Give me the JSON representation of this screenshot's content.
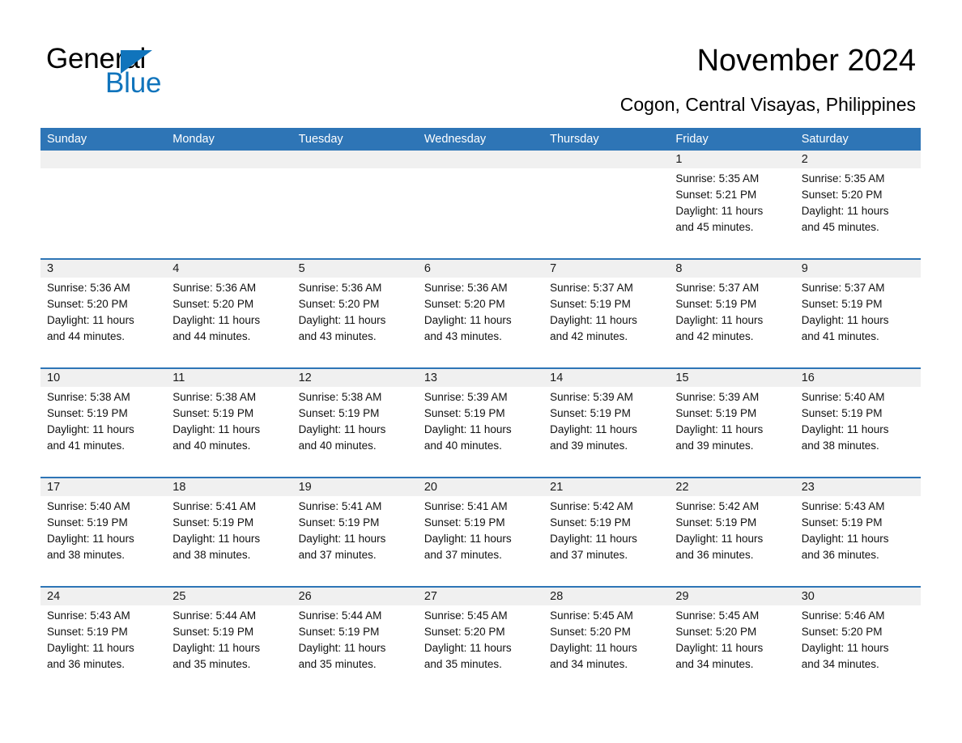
{
  "brand": {
    "name_part1": "General",
    "name_part2": "Blue",
    "accent_color": "#1074bc",
    "triangle_icon": "triangle-icon"
  },
  "header": {
    "title": "November 2024",
    "subtitle": "Cogon, Central Visayas, Philippines"
  },
  "calendar": {
    "header_bg": "#2e75b6",
    "band_bg": "#f0f0f0",
    "weekdays": [
      "Sunday",
      "Monday",
      "Tuesday",
      "Wednesday",
      "Thursday",
      "Friday",
      "Saturday"
    ],
    "weeks": [
      [
        {
          "day": "",
          "empty": true
        },
        {
          "day": "",
          "empty": true
        },
        {
          "day": "",
          "empty": true
        },
        {
          "day": "",
          "empty": true
        },
        {
          "day": "",
          "empty": true
        },
        {
          "day": "1",
          "sunrise": "Sunrise: 5:35 AM",
          "sunset": "Sunset: 5:21 PM",
          "daylight1": "Daylight: 11 hours",
          "daylight2": "and 45 minutes."
        },
        {
          "day": "2",
          "sunrise": "Sunrise: 5:35 AM",
          "sunset": "Sunset: 5:20 PM",
          "daylight1": "Daylight: 11 hours",
          "daylight2": "and 45 minutes."
        }
      ],
      [
        {
          "day": "3",
          "sunrise": "Sunrise: 5:36 AM",
          "sunset": "Sunset: 5:20 PM",
          "daylight1": "Daylight: 11 hours",
          "daylight2": "and 44 minutes."
        },
        {
          "day": "4",
          "sunrise": "Sunrise: 5:36 AM",
          "sunset": "Sunset: 5:20 PM",
          "daylight1": "Daylight: 11 hours",
          "daylight2": "and 44 minutes."
        },
        {
          "day": "5",
          "sunrise": "Sunrise: 5:36 AM",
          "sunset": "Sunset: 5:20 PM",
          "daylight1": "Daylight: 11 hours",
          "daylight2": "and 43 minutes."
        },
        {
          "day": "6",
          "sunrise": "Sunrise: 5:36 AM",
          "sunset": "Sunset: 5:20 PM",
          "daylight1": "Daylight: 11 hours",
          "daylight2": "and 43 minutes."
        },
        {
          "day": "7",
          "sunrise": "Sunrise: 5:37 AM",
          "sunset": "Sunset: 5:19 PM",
          "daylight1": "Daylight: 11 hours",
          "daylight2": "and 42 minutes."
        },
        {
          "day": "8",
          "sunrise": "Sunrise: 5:37 AM",
          "sunset": "Sunset: 5:19 PM",
          "daylight1": "Daylight: 11 hours",
          "daylight2": "and 42 minutes."
        },
        {
          "day": "9",
          "sunrise": "Sunrise: 5:37 AM",
          "sunset": "Sunset: 5:19 PM",
          "daylight1": "Daylight: 11 hours",
          "daylight2": "and 41 minutes."
        }
      ],
      [
        {
          "day": "10",
          "sunrise": "Sunrise: 5:38 AM",
          "sunset": "Sunset: 5:19 PM",
          "daylight1": "Daylight: 11 hours",
          "daylight2": "and 41 minutes."
        },
        {
          "day": "11",
          "sunrise": "Sunrise: 5:38 AM",
          "sunset": "Sunset: 5:19 PM",
          "daylight1": "Daylight: 11 hours",
          "daylight2": "and 40 minutes."
        },
        {
          "day": "12",
          "sunrise": "Sunrise: 5:38 AM",
          "sunset": "Sunset: 5:19 PM",
          "daylight1": "Daylight: 11 hours",
          "daylight2": "and 40 minutes."
        },
        {
          "day": "13",
          "sunrise": "Sunrise: 5:39 AM",
          "sunset": "Sunset: 5:19 PM",
          "daylight1": "Daylight: 11 hours",
          "daylight2": "and 40 minutes."
        },
        {
          "day": "14",
          "sunrise": "Sunrise: 5:39 AM",
          "sunset": "Sunset: 5:19 PM",
          "daylight1": "Daylight: 11 hours",
          "daylight2": "and 39 minutes."
        },
        {
          "day": "15",
          "sunrise": "Sunrise: 5:39 AM",
          "sunset": "Sunset: 5:19 PM",
          "daylight1": "Daylight: 11 hours",
          "daylight2": "and 39 minutes."
        },
        {
          "day": "16",
          "sunrise": "Sunrise: 5:40 AM",
          "sunset": "Sunset: 5:19 PM",
          "daylight1": "Daylight: 11 hours",
          "daylight2": "and 38 minutes."
        }
      ],
      [
        {
          "day": "17",
          "sunrise": "Sunrise: 5:40 AM",
          "sunset": "Sunset: 5:19 PM",
          "daylight1": "Daylight: 11 hours",
          "daylight2": "and 38 minutes."
        },
        {
          "day": "18",
          "sunrise": "Sunrise: 5:41 AM",
          "sunset": "Sunset: 5:19 PM",
          "daylight1": "Daylight: 11 hours",
          "daylight2": "and 38 minutes."
        },
        {
          "day": "19",
          "sunrise": "Sunrise: 5:41 AM",
          "sunset": "Sunset: 5:19 PM",
          "daylight1": "Daylight: 11 hours",
          "daylight2": "and 37 minutes."
        },
        {
          "day": "20",
          "sunrise": "Sunrise: 5:41 AM",
          "sunset": "Sunset: 5:19 PM",
          "daylight1": "Daylight: 11 hours",
          "daylight2": "and 37 minutes."
        },
        {
          "day": "21",
          "sunrise": "Sunrise: 5:42 AM",
          "sunset": "Sunset: 5:19 PM",
          "daylight1": "Daylight: 11 hours",
          "daylight2": "and 37 minutes."
        },
        {
          "day": "22",
          "sunrise": "Sunrise: 5:42 AM",
          "sunset": "Sunset: 5:19 PM",
          "daylight1": "Daylight: 11 hours",
          "daylight2": "and 36 minutes."
        },
        {
          "day": "23",
          "sunrise": "Sunrise: 5:43 AM",
          "sunset": "Sunset: 5:19 PM",
          "daylight1": "Daylight: 11 hours",
          "daylight2": "and 36 minutes."
        }
      ],
      [
        {
          "day": "24",
          "sunrise": "Sunrise: 5:43 AM",
          "sunset": "Sunset: 5:19 PM",
          "daylight1": "Daylight: 11 hours",
          "daylight2": "and 36 minutes."
        },
        {
          "day": "25",
          "sunrise": "Sunrise: 5:44 AM",
          "sunset": "Sunset: 5:19 PM",
          "daylight1": "Daylight: 11 hours",
          "daylight2": "and 35 minutes."
        },
        {
          "day": "26",
          "sunrise": "Sunrise: 5:44 AM",
          "sunset": "Sunset: 5:19 PM",
          "daylight1": "Daylight: 11 hours",
          "daylight2": "and 35 minutes."
        },
        {
          "day": "27",
          "sunrise": "Sunrise: 5:45 AM",
          "sunset": "Sunset: 5:20 PM",
          "daylight1": "Daylight: 11 hours",
          "daylight2": "and 35 minutes."
        },
        {
          "day": "28",
          "sunrise": "Sunrise: 5:45 AM",
          "sunset": "Sunset: 5:20 PM",
          "daylight1": "Daylight: 11 hours",
          "daylight2": "and 34 minutes."
        },
        {
          "day": "29",
          "sunrise": "Sunrise: 5:45 AM",
          "sunset": "Sunset: 5:20 PM",
          "daylight1": "Daylight: 11 hours",
          "daylight2": "and 34 minutes."
        },
        {
          "day": "30",
          "sunrise": "Sunrise: 5:46 AM",
          "sunset": "Sunset: 5:20 PM",
          "daylight1": "Daylight: 11 hours",
          "daylight2": "and 34 minutes."
        }
      ]
    ]
  }
}
